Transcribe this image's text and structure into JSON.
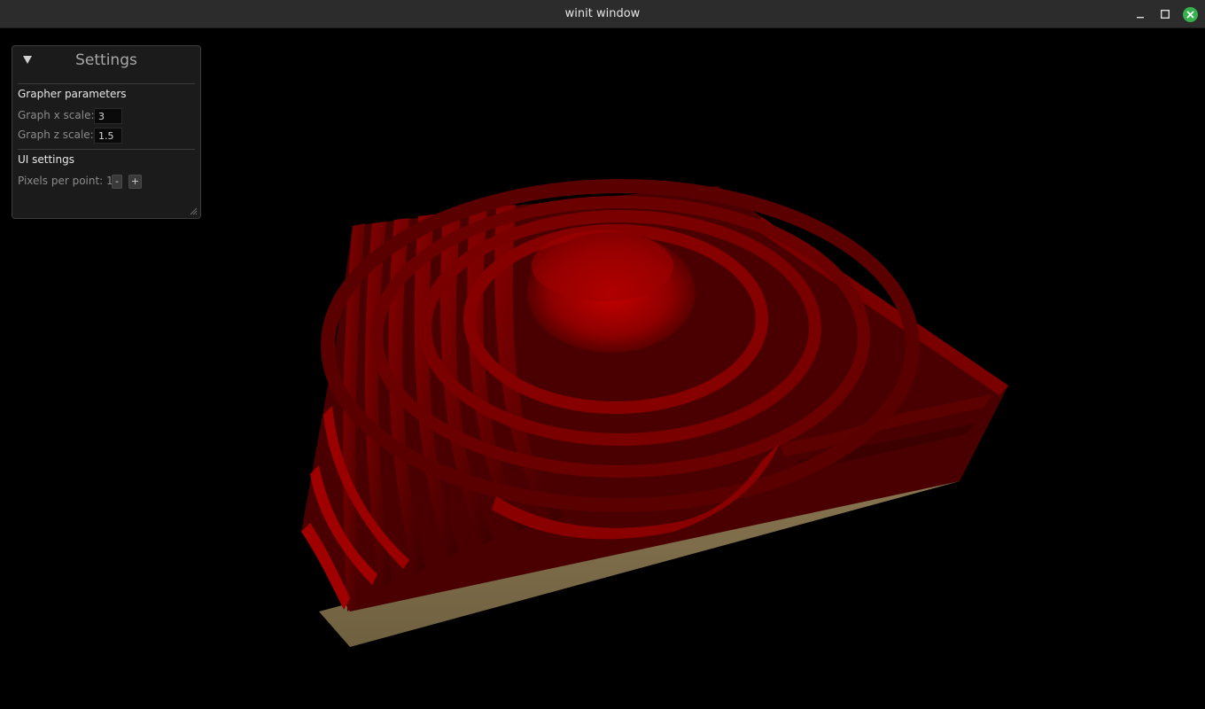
{
  "window": {
    "title": "winit window",
    "controls": {
      "minimize_icon": "minimize-icon",
      "maximize_icon": "maximize-icon",
      "close_icon": "close-icon"
    }
  },
  "settings_panel": {
    "title": "Settings",
    "collapse_icon": "triangle-down-icon",
    "grapher": {
      "heading": "Grapher parameters",
      "x_scale_label": "Graph x scale:",
      "x_scale_value": "3",
      "z_scale_label": "Graph z scale:",
      "z_scale_value": "1.5"
    },
    "ui": {
      "heading": "UI settings",
      "pixels_label": "Pixels per point: 1",
      "minus_label": "-",
      "plus_label": "+"
    }
  },
  "colors": {
    "surface": "#8b0000",
    "floor": "#7a6a48",
    "background": "#000000",
    "panel": "#1b1b1b",
    "close_button": "#35b24d"
  }
}
